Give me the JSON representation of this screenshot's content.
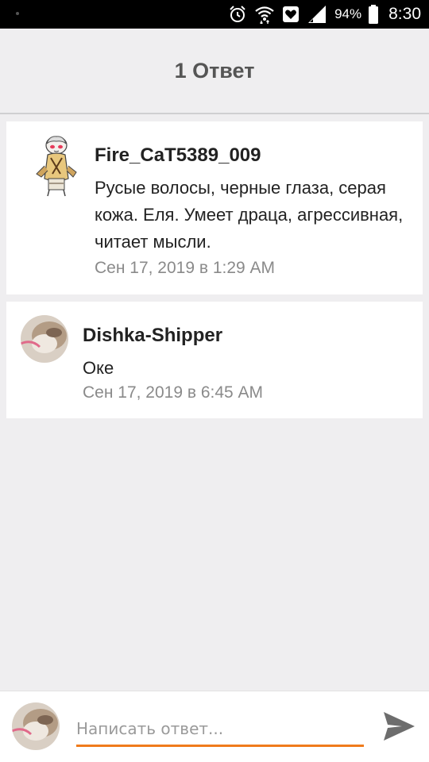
{
  "status_bar": {
    "battery": "94%",
    "time": "8:30",
    "icons": [
      "alarm-icon",
      "wifi-icon",
      "notification-icon",
      "signal-icon",
      "battery-icon"
    ]
  },
  "header": {
    "title": "1 Ответ"
  },
  "comments": [
    {
      "username": "Fire_CaT5389_009",
      "message": "Русые волосы, черные глаза, серая кожа. Еля. Умеет драца, агрессивная, читает мысли.",
      "timestamp": "Сен 17, 2019 в 1:29 AM"
    },
    {
      "username": "Dishka-Shipper",
      "message": "Оке",
      "timestamp": "Сен 17, 2019 в 6:45 AM"
    }
  ],
  "composer": {
    "placeholder": "Написать ответ..."
  },
  "colors": {
    "accent": "#f07b1c",
    "background": "#efeef0"
  }
}
